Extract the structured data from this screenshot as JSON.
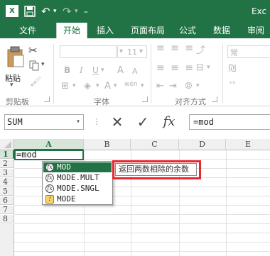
{
  "window": {
    "app_title": "Exc"
  },
  "quick_access": {
    "undo_icon": "↶",
    "redo_icon": "↷",
    "customize_icon": "⩩"
  },
  "tabs": [
    {
      "label": "文件"
    },
    {
      "label": "开始"
    },
    {
      "label": "插入"
    },
    {
      "label": "页面布局"
    },
    {
      "label": "公式"
    },
    {
      "label": "数据"
    },
    {
      "label": "审阅"
    }
  ],
  "ribbon": {
    "paste_label": "粘贴",
    "font_size": "11",
    "bold": "B",
    "italic": "I",
    "underline": "U",
    "grow_font": "A",
    "shrink_font": "A",
    "phonetic": "wén",
    "groups": [
      {
        "label": "剪贴板"
      },
      {
        "label": "字体"
      },
      {
        "label": "对齐方式"
      }
    ],
    "number_label": "常"
  },
  "formula_bar": {
    "name_box": "SUM",
    "cancel": "✕",
    "enter": "✓",
    "insert_function": "fx",
    "formula": "=mod"
  },
  "sheet": {
    "columns": [
      "A",
      "B",
      "C",
      "D",
      "E"
    ],
    "rows": [
      "1",
      "2",
      "3",
      "4",
      "5",
      "6",
      "7",
      "8"
    ],
    "active_cell_value": "=mod"
  },
  "autocomplete": {
    "items": [
      {
        "label": "MOD",
        "icon": "fx"
      },
      {
        "label": "MODE.MULT",
        "icon": "fx"
      },
      {
        "label": "MODE.SNGL",
        "icon": "fx"
      },
      {
        "label": "MODE",
        "icon": "!"
      }
    ],
    "tooltip": "返回两数相除的余数"
  },
  "colors": {
    "excel_green": "#217346",
    "highlight_red": "#e8262e"
  }
}
